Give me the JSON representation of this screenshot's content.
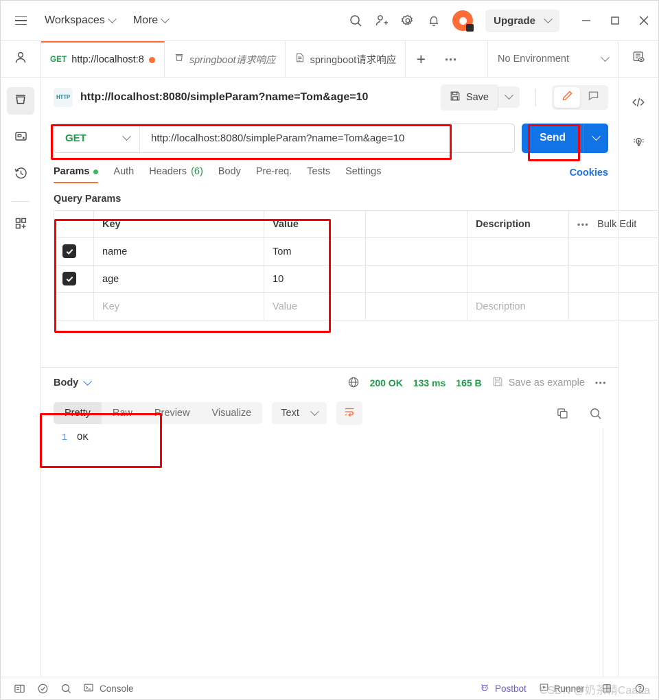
{
  "header": {
    "menu_icon": "hamburger-icon",
    "workspaces_label": "Workspaces",
    "more_label": "More",
    "search_icon": "search-icon",
    "invite_icon": "invite-user-icon",
    "settings_icon": "gear-icon",
    "notifications_icon": "bell-icon",
    "account_icon": "postman-avatar-icon",
    "upgrade_label": "Upgrade",
    "minimize_label": "—",
    "maximize_label": "□",
    "close_label": "✕"
  },
  "left_rail": {
    "items": [
      {
        "name": "profile-icon"
      },
      {
        "name": "collections-icon"
      },
      {
        "name": "apis-icon"
      },
      {
        "name": "history-icon"
      },
      {
        "name": "new-icon"
      }
    ]
  },
  "right_rail": {
    "items": [
      {
        "name": "documentation-icon"
      },
      {
        "name": "code-snippet-icon"
      },
      {
        "name": "postbot-lightbulb-icon"
      }
    ]
  },
  "tabstrip": {
    "tabs": [
      {
        "method": "GET",
        "title": "http://localhost:8",
        "unsaved": true,
        "active": true,
        "icon": ""
      },
      {
        "method": "",
        "title": "springboot请求响应",
        "unsaved": false,
        "active": false,
        "icon": "collection-icon"
      },
      {
        "method": "",
        "title": "springboot请求响应",
        "unsaved": false,
        "active": false,
        "icon": "document-icon"
      }
    ],
    "add_tab_label": "+",
    "more_tabs_label": "•••",
    "environment_label": "No Environment",
    "env_view_icon": "environment-quick-look-icon"
  },
  "request": {
    "protocol_badge": "HTTP",
    "title": "http://localhost:8080/simpleParam?name=Tom&age=10",
    "save_label": "Save",
    "save_icon": "floppy-disk-icon",
    "save_dropdown_icon": "chevron-down-icon",
    "edit_icon": "pencil-icon",
    "comment_icon": "comment-icon",
    "method": "GET",
    "url": "http://localhost:8080/simpleParam?name=Tom&age=10",
    "send_label": "Send",
    "send_dropdown_icon": "chevron-down-icon"
  },
  "request_tabs": {
    "items": [
      {
        "label": "Params",
        "badge": "dot",
        "active": true
      },
      {
        "label": "Auth",
        "badge": "",
        "active": false
      },
      {
        "label": "Headers",
        "badge": "(6)",
        "active": false
      },
      {
        "label": "Body",
        "badge": "",
        "active": false
      },
      {
        "label": "Pre-req.",
        "badge": "",
        "active": false
      },
      {
        "label": "Tests",
        "badge": "",
        "active": false
      },
      {
        "label": "Settings",
        "badge": "",
        "active": false
      }
    ],
    "cookies_label": "Cookies"
  },
  "query_params": {
    "section_title": "Query Params",
    "columns": [
      "",
      "Key",
      "Value",
      "",
      "Description",
      ""
    ],
    "header_key": "Key",
    "header_value": "Value",
    "header_description": "Description",
    "bulk_edit_label": "Bulk Edit",
    "more_icon": "•••",
    "rows": [
      {
        "checked": true,
        "key": "name",
        "value": "Tom",
        "description": ""
      },
      {
        "checked": true,
        "key": "age",
        "value": "10",
        "description": ""
      }
    ],
    "placeholder_row": {
      "key": "Key",
      "value": "Value",
      "description": "Description"
    }
  },
  "response": {
    "body_label": "Body",
    "globe_icon": "globe-icon",
    "status": "200 OK",
    "time": "133 ms",
    "size": "165 B",
    "save_example_label": "Save as example",
    "save_example_icon": "floppy-disk-icon",
    "more_icon": "•••",
    "view_tabs": [
      {
        "label": "Pretty",
        "active": true
      },
      {
        "label": "Raw",
        "active": false
      },
      {
        "label": "Preview",
        "active": false
      },
      {
        "label": "Visualize",
        "active": false
      }
    ],
    "format": "Text",
    "wrap_icon": "wrap-lines-icon",
    "copy_icon": "copy-icon",
    "search_icon": "search-icon",
    "lines": [
      {
        "number": "1",
        "text": "OK"
      }
    ]
  },
  "footer": {
    "sidebar_toggle_icon": "sidebar-toggle-icon",
    "status_icon": "check-circle-icon",
    "find_icon": "search-icon",
    "console_label": "Console",
    "console_icon": "terminal-icon",
    "postbot_label": "Postbot",
    "postbot_icon": "postbot-icon",
    "runner_label": "Runner",
    "runner_icon": "play-icon",
    "layout_icon": "layout-icon",
    "help_icon": "help-icon"
  },
  "watermark": {
    "text": "CSDN @奶茶精Caaaa"
  },
  "colors": {
    "accent": "#ff6c37",
    "send_blue": "#1073e6",
    "success_green": "#1f9b4b",
    "highlight_red": "#fb0000",
    "link_blue": "#1f6fe0"
  }
}
